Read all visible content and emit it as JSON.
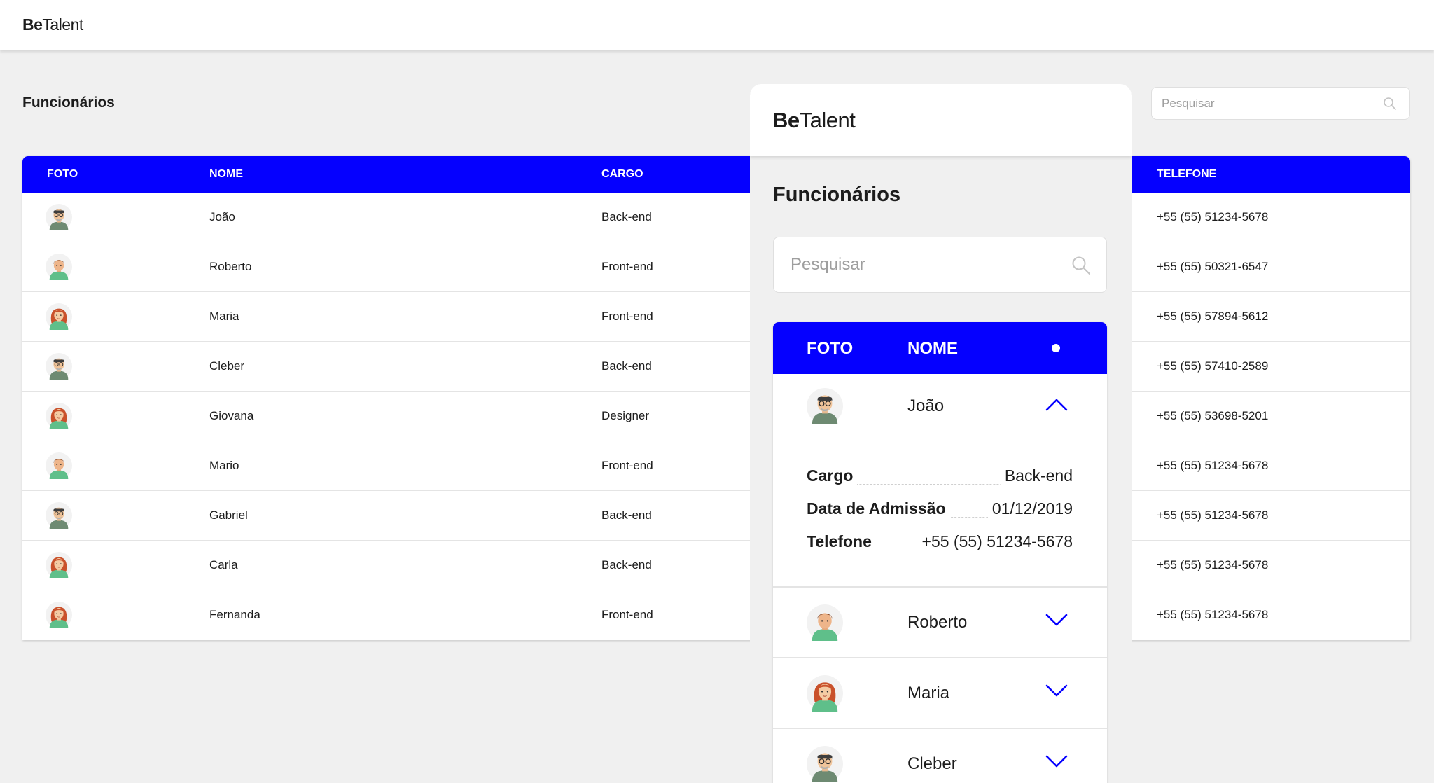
{
  "app": {
    "logo_bold": "Be",
    "logo_rest": "Talent"
  },
  "desktop": {
    "title": "Funcionários",
    "search_placeholder": "Pesquisar",
    "columns": {
      "foto": "FOTO",
      "nome": "NOME",
      "cargo": "CARGO",
      "telefone": "TELEFONE"
    },
    "rows": [
      {
        "nome": "João",
        "cargo": "Back-end",
        "telefone": "+55 (55) 51234-5678",
        "avatar": "male-glasses"
      },
      {
        "nome": "Roberto",
        "cargo": "Front-end",
        "telefone": "+55 (55) 50321-6547",
        "avatar": "male-young"
      },
      {
        "nome": "Maria",
        "cargo": "Front-end",
        "telefone": "+55 (55) 57894-5612",
        "avatar": "female"
      },
      {
        "nome": "Cleber",
        "cargo": "Back-end",
        "telefone": "+55 (55) 57410-2589",
        "avatar": "male-glasses"
      },
      {
        "nome": "Giovana",
        "cargo": "Designer",
        "telefone": "+55 (55) 53698-5201",
        "avatar": "female"
      },
      {
        "nome": "Mario",
        "cargo": "Front-end",
        "telefone": "+55 (55) 51234-5678",
        "avatar": "male-young"
      },
      {
        "nome": "Gabriel",
        "cargo": "Back-end",
        "telefone": "+55 (55) 51234-5678",
        "avatar": "male-glasses"
      },
      {
        "nome": "Carla",
        "cargo": "Back-end",
        "telefone": "+55 (55) 51234-5678",
        "avatar": "female"
      },
      {
        "nome": "Fernanda",
        "cargo": "Front-end",
        "telefone": "+55 (55) 51234-5678",
        "avatar": "female"
      }
    ]
  },
  "mobile": {
    "title": "Funcionários",
    "search_placeholder": "Pesquisar",
    "columns": {
      "foto": "FOTO",
      "nome": "NOME"
    },
    "expanded": {
      "nome": "João",
      "avatar": "male-glasses",
      "details": [
        {
          "label": "Cargo",
          "value": "Back-end"
        },
        {
          "label": "Data de Admissão",
          "value": "01/12/2019"
        },
        {
          "label": "Telefone",
          "value": "+55 (55) 51234-5678"
        }
      ]
    },
    "collapsed_rows": [
      {
        "nome": "Roberto",
        "avatar": "male-young"
      },
      {
        "nome": "Maria",
        "avatar": "female"
      },
      {
        "nome": "Cleber",
        "avatar": "male-glasses"
      }
    ]
  },
  "colors": {
    "accent": "#0500ff",
    "background": "#f0f0f0",
    "surface": "#ffffff"
  },
  "icons": {
    "search": "search-icon",
    "expand": "chevron-down-icon",
    "collapse": "chevron-up-icon",
    "menu_dot": "dot-icon"
  }
}
